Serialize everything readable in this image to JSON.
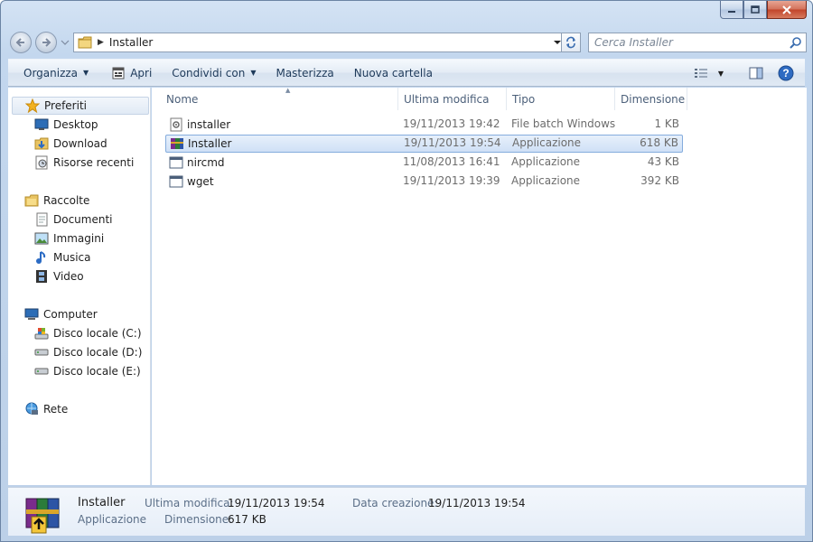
{
  "window": {
    "caption": {
      "minimize": "minimize",
      "maximize": "maximize",
      "close": "close"
    }
  },
  "address": {
    "path": "Installer",
    "search_placeholder": "Cerca Installer"
  },
  "toolbar": {
    "organize": "Organizza",
    "open": "Apri",
    "share": "Condividi con",
    "burn": "Masterizza",
    "new_folder": "Nuova cartella"
  },
  "nav": {
    "favorites": {
      "label": "Preferiti",
      "items": [
        {
          "label": "Desktop",
          "icon": "desktop-icon"
        },
        {
          "label": "Download",
          "icon": "download-folder-icon"
        },
        {
          "label": "Risorse recenti",
          "icon": "recent-places-icon"
        }
      ]
    },
    "libraries": {
      "label": "Raccolte",
      "items": [
        {
          "label": "Documenti",
          "icon": "documents-icon"
        },
        {
          "label": "Immagini",
          "icon": "pictures-icon"
        },
        {
          "label": "Musica",
          "icon": "music-icon"
        },
        {
          "label": "Video",
          "icon": "video-icon"
        }
      ]
    },
    "computer": {
      "label": "Computer",
      "items": [
        {
          "label": "Disco locale (C:)",
          "icon": "system-drive-icon"
        },
        {
          "label": "Disco locale (D:)",
          "icon": "drive-icon"
        },
        {
          "label": "Disco locale (E:)",
          "icon": "drive-icon"
        }
      ]
    },
    "network": {
      "label": "Rete"
    }
  },
  "columns": {
    "name": "Nome",
    "modified": "Ultima modifica",
    "type": "Tipo",
    "size": "Dimensione"
  },
  "files": [
    {
      "name": "installer",
      "modified": "19/11/2013 19:42",
      "type": "File batch Windows",
      "size": "1 KB",
      "icon": "batch-file-icon",
      "selected": false
    },
    {
      "name": "Installer",
      "modified": "19/11/2013 19:54",
      "type": "Applicazione",
      "size": "618 KB",
      "icon": "winrar-archive-icon",
      "selected": true
    },
    {
      "name": "nircmd",
      "modified": "11/08/2013 16:41",
      "type": "Applicazione",
      "size": "43 KB",
      "icon": "application-icon",
      "selected": false
    },
    {
      "name": "wget",
      "modified": "19/11/2013 19:39",
      "type": "Applicazione",
      "size": "392 KB",
      "icon": "application-icon",
      "selected": false
    }
  ],
  "details": {
    "name": "Installer",
    "type": "Applicazione",
    "modified_label": "Ultima modifica:",
    "modified_value": "19/11/2013 19:54",
    "size_label": "Dimensione:",
    "size_value": "617 KB",
    "created_label": "Data creazione:",
    "created_value": "19/11/2013 19:54"
  },
  "colors": {
    "accent": "#3a78c4",
    "selection": "#cfe0f6",
    "frame": "#c3d7ee"
  }
}
